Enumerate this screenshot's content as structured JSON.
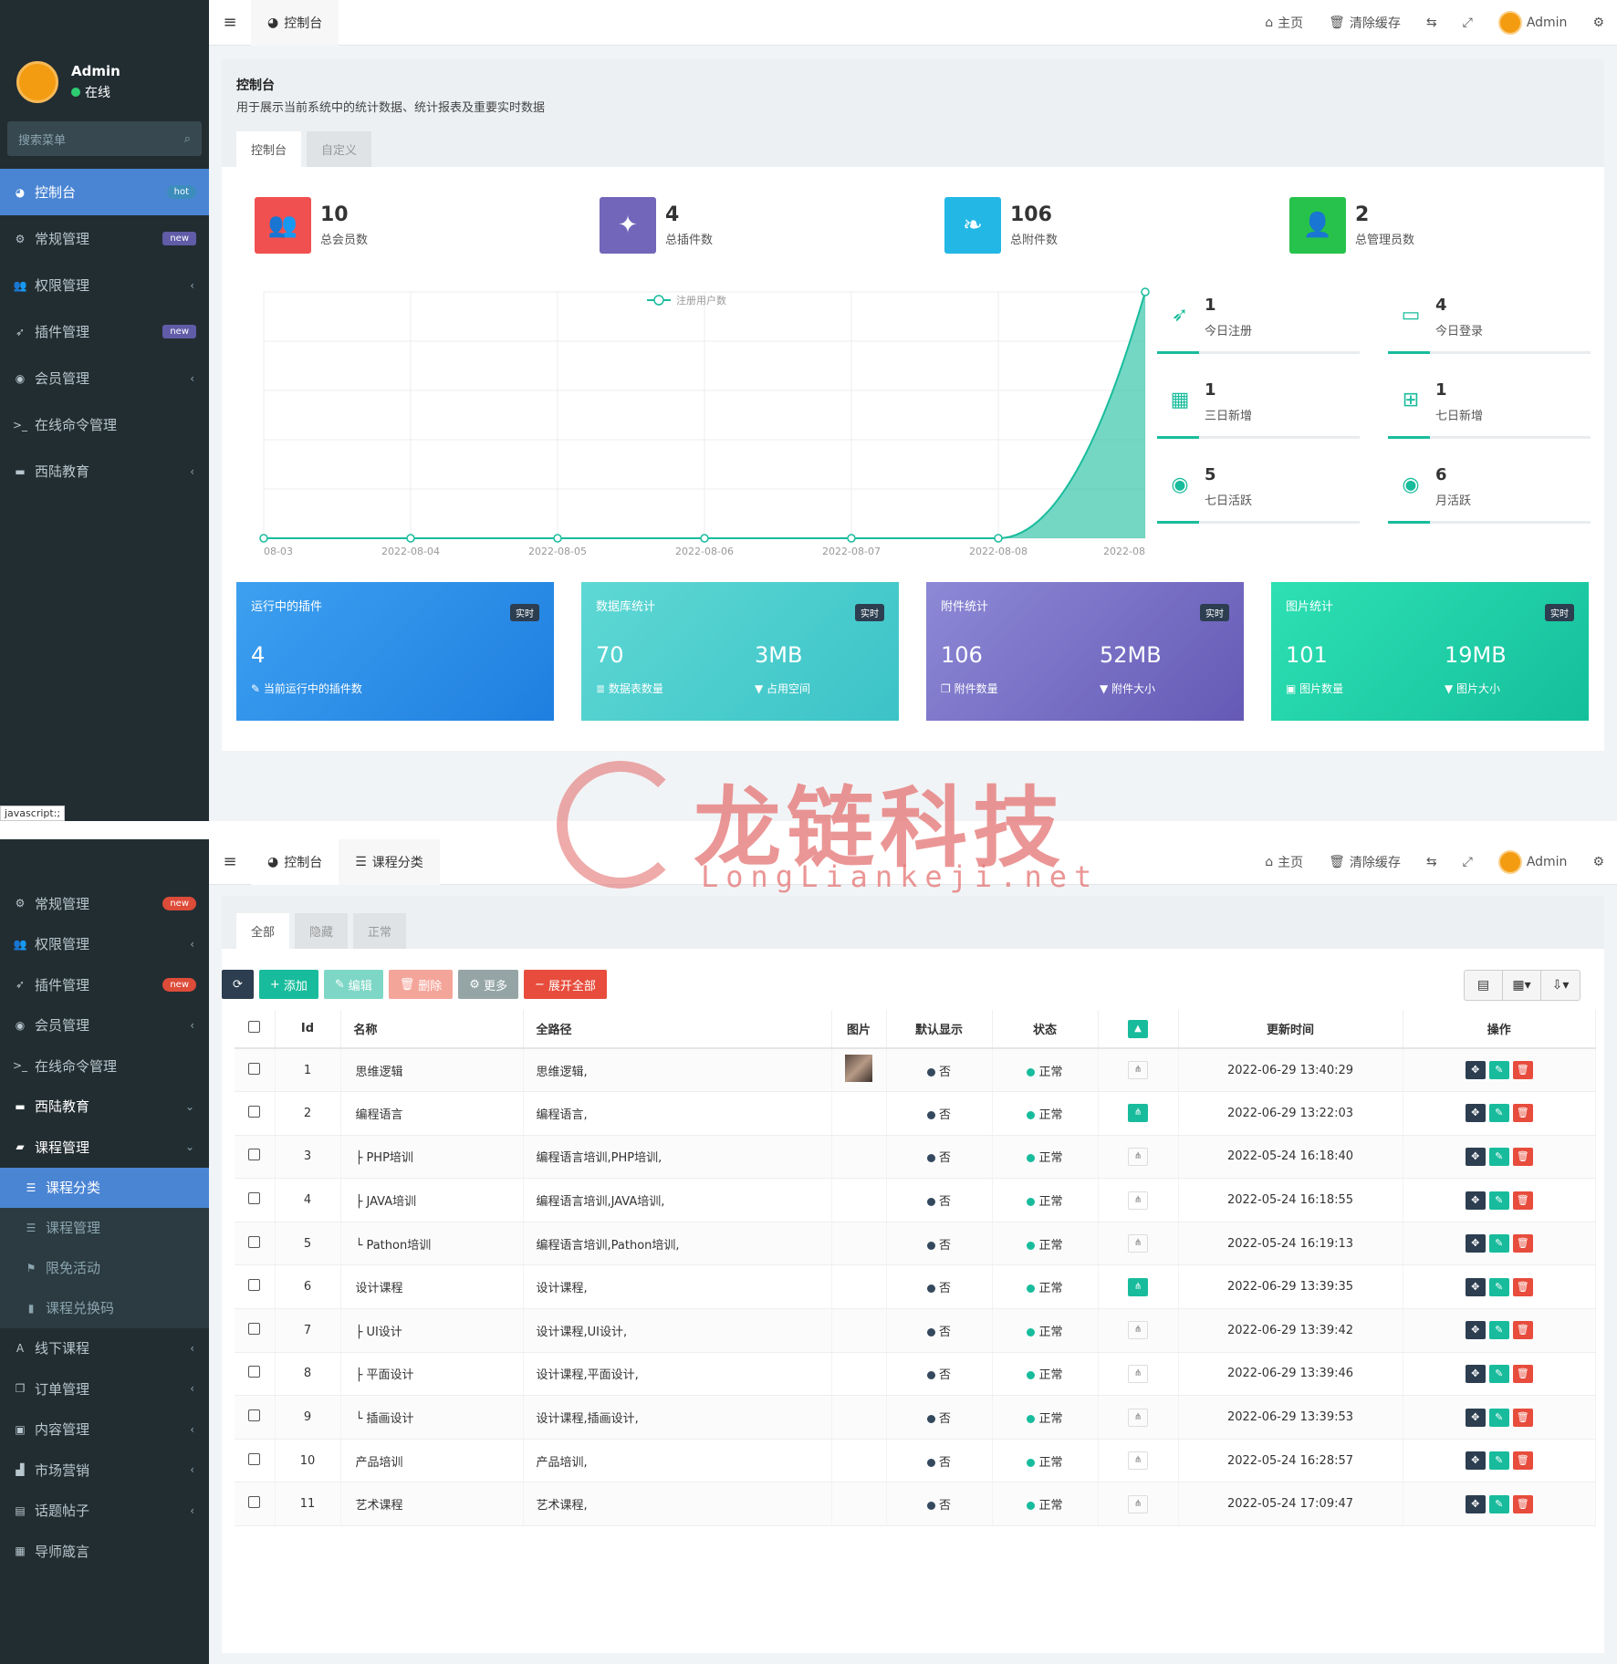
{
  "user": {
    "name": "Admin",
    "status": "在线"
  },
  "search_placeholder": "搜索菜单",
  "menu1": [
    {
      "label": "控制台",
      "icon": "dashboard-icon",
      "badge": "hot",
      "active": true
    },
    {
      "label": "常规管理",
      "icon": "cogs-icon",
      "badge": "new"
    },
    {
      "label": "权限管理",
      "icon": "users-icon",
      "chev": "‹"
    },
    {
      "label": "插件管理",
      "icon": "rocket-icon",
      "badge": "new"
    },
    {
      "label": "会员管理",
      "icon": "user-circle-icon",
      "chev": "‹"
    },
    {
      "label": "在线命令管理",
      "icon": "terminal-icon"
    },
    {
      "label": "西陆教育",
      "icon": "folder-icon",
      "chev": "‹"
    }
  ],
  "status_bar": "javascript:;",
  "top1": {
    "tab": "控制台",
    "home": "主页",
    "clear": "清除缓存",
    "admin": "Admin"
  },
  "header": {
    "title": "控制台",
    "desc": "用于展示当前系统中的统计数据、统计报表及重要实时数据",
    "tabs": [
      "控制台",
      "自定义"
    ]
  },
  "stats": [
    {
      "value": "10",
      "label": "总会员数",
      "color": "#f05050"
    },
    {
      "value": "4",
      "label": "总插件数",
      "color": "#7266ba"
    },
    {
      "value": "106",
      "label": "总附件数",
      "color": "#23b7e5"
    },
    {
      "value": "2",
      "label": "总管理员数",
      "color": "#27c24c"
    }
  ],
  "chart_data": {
    "type": "area",
    "legend": "注册用户数",
    "x": [
      "08-03",
      "2022-08-04",
      "2022-08-05",
      "2022-08-06",
      "2022-08-07",
      "2022-08-08",
      "2022-08"
    ],
    "values": [
      0,
      0,
      0,
      0,
      0,
      0,
      1
    ],
    "color": "#18bc9c"
  },
  "minis": [
    {
      "value": "1",
      "label": "今日注册",
      "icon": "rocket-icon"
    },
    {
      "value": "4",
      "label": "今日登录",
      "icon": "id-card-icon"
    },
    {
      "value": "1",
      "label": "三日新增",
      "icon": "calendar-icon"
    },
    {
      "value": "1",
      "label": "七日新增",
      "icon": "calendar-plus-icon"
    },
    {
      "value": "5",
      "label": "七日活跃",
      "icon": "user-circle-icon"
    },
    {
      "value": "6",
      "label": "月活跃",
      "icon": "user-circle-icon"
    }
  ],
  "cards": [
    {
      "title": "运行中的插件",
      "tag": "实时",
      "v1": "4",
      "l1": "当前运行中的插件数",
      "v2": "",
      "l2": ""
    },
    {
      "title": "数据库统计",
      "tag": "实时",
      "v1": "70",
      "l1": "数据表数量",
      "v2": "3MB",
      "l2": "占用空间"
    },
    {
      "title": "附件统计",
      "tag": "实时",
      "v1": "106",
      "l1": "附件数量",
      "v2": "52MB",
      "l2": "附件大小"
    },
    {
      "title": "图片统计",
      "tag": "实时",
      "v1": "101",
      "l1": "图片数量",
      "v2": "19MB",
      "l2": "图片大小"
    }
  ],
  "watermark": {
    "big": "龙链科技",
    "small": "LongLiankeji.net"
  },
  "menu2": [
    {
      "label": "常规管理",
      "badge": "new",
      "icon": "cogs-icon"
    },
    {
      "label": "权限管理",
      "chev": "‹",
      "icon": "users-icon"
    },
    {
      "label": "插件管理",
      "badge": "new",
      "icon": "rocket-icon"
    },
    {
      "label": "会员管理",
      "chev": "‹",
      "icon": "user-circle-icon"
    },
    {
      "label": "在线命令管理",
      "icon": "terminal-icon"
    },
    {
      "label": "西陆教育",
      "chev": "⌄",
      "icon": "folder-icon",
      "bright": true
    },
    {
      "label": "课程管理",
      "chev": "⌄",
      "icon": "book-icon",
      "bright": true
    },
    {
      "label": "课程分类",
      "icon": "list-icon",
      "subact": true
    },
    {
      "label": "课程管理",
      "icon": "list-icon",
      "sub": true
    },
    {
      "label": "限免活动",
      "icon": "flag-icon",
      "sub": true
    },
    {
      "label": "课程兑换码",
      "icon": "bookmark-icon",
      "sub": true
    },
    {
      "label": "线下课程",
      "chev": "‹",
      "icon": "font-icon"
    },
    {
      "label": "订单管理",
      "chev": "‹",
      "icon": "copy-icon"
    },
    {
      "label": "内容管理",
      "chev": "‹",
      "icon": "image-icon"
    },
    {
      "label": "市场营销",
      "chev": "‹",
      "icon": "chart-icon"
    },
    {
      "label": "话题帖子",
      "chev": "‹",
      "icon": "file-icon"
    },
    {
      "label": "导师箴言",
      "icon": "calendar-icon"
    }
  ],
  "top2": {
    "tab1": "控制台",
    "tab2": "课程分类",
    "home": "主页",
    "clear": "清除缓存",
    "admin": "Admin"
  },
  "filter_tabs": [
    "全部",
    "隐藏",
    "正常"
  ],
  "toolbar": {
    "add": "添加",
    "edit": "编辑",
    "del": "删除",
    "more": "更多",
    "expand": "展开全部"
  },
  "columns": [
    "Id",
    "名称",
    "全路径",
    "图片",
    "默认显示",
    "状态",
    "更新时间",
    "操作"
  ],
  "rows": [
    {
      "id": "1",
      "name": "思维逻辑",
      "path": "思维逻辑,",
      "img": true,
      "def": "否",
      "status": "正常",
      "tree_on": false,
      "time": "2022-06-29 13:40:29"
    },
    {
      "id": "2",
      "name": "编程语言",
      "path": "编程语言,",
      "img": false,
      "def": "否",
      "status": "正常",
      "tree_on": true,
      "time": "2022-06-29 13:22:03"
    },
    {
      "id": "3",
      "name": "├ PHP培训",
      "path": "编程语言培训,PHP培训,",
      "img": false,
      "def": "否",
      "status": "正常",
      "tree_on": false,
      "time": "2022-05-24 16:18:40"
    },
    {
      "id": "4",
      "name": "├ JAVA培训",
      "path": "编程语言培训,JAVA培训,",
      "img": false,
      "def": "否",
      "status": "正常",
      "tree_on": false,
      "time": "2022-05-24 16:18:55"
    },
    {
      "id": "5",
      "name": "└ Pathon培训",
      "path": "编程语言培训,Pathon培训,",
      "img": false,
      "def": "否",
      "status": "正常",
      "tree_on": false,
      "time": "2022-05-24 16:19:13"
    },
    {
      "id": "6",
      "name": "设计课程",
      "path": "设计课程,",
      "img": false,
      "def": "否",
      "status": "正常",
      "tree_on": true,
      "time": "2022-06-29 13:39:35"
    },
    {
      "id": "7",
      "name": "├ UI设计",
      "path": "设计课程,UI设计,",
      "img": false,
      "def": "否",
      "status": "正常",
      "tree_on": false,
      "time": "2022-06-29 13:39:42"
    },
    {
      "id": "8",
      "name": "├ 平面设计",
      "path": "设计课程,平面设计,",
      "img": false,
      "def": "否",
      "status": "正常",
      "tree_on": false,
      "time": "2022-06-29 13:39:46"
    },
    {
      "id": "9",
      "name": "└ 插画设计",
      "path": "设计课程,插画设计,",
      "img": false,
      "def": "否",
      "status": "正常",
      "tree_on": false,
      "time": "2022-06-29 13:39:53"
    },
    {
      "id": "10",
      "name": "产品培训",
      "path": "产品培训,",
      "img": false,
      "def": "否",
      "status": "正常",
      "tree_on": false,
      "time": "2022-05-24 16:28:57"
    },
    {
      "id": "11",
      "name": "艺术课程",
      "path": "艺术课程,",
      "img": false,
      "def": "否",
      "status": "正常",
      "tree_on": false,
      "time": "2022-05-24 17:09:47"
    }
  ]
}
